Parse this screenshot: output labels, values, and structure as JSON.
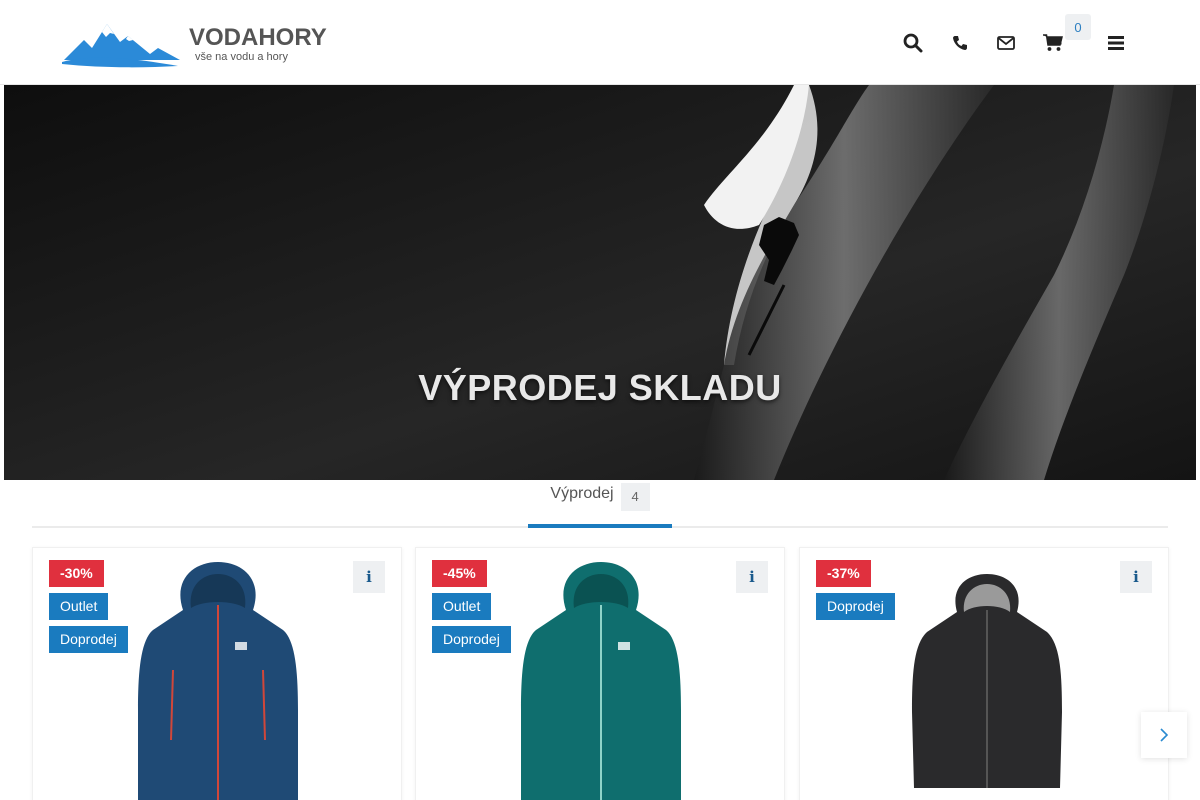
{
  "brand": {
    "name": "VODAHORY",
    "tagline": "vše na vodu a hory",
    "colors": {
      "primary": "#1a7bbf",
      "sale": "#e0303e",
      "logo_mountain": "#2b8ad8"
    }
  },
  "header": {
    "icons": [
      "search-icon",
      "phone-icon",
      "envelope-icon",
      "cart-icon",
      "menu-icon"
    ],
    "cart_count": "0"
  },
  "hero": {
    "title": "VÝPRODEJ SKLADU"
  },
  "tabs": [
    {
      "label": "Výprodej",
      "count": "4",
      "active": true
    }
  ],
  "products": [
    {
      "discount": "-30%",
      "labels": [
        "Outlet",
        "Doprodej"
      ],
      "color": "#1f4a75",
      "accent": "#d0473a"
    },
    {
      "discount": "-45%",
      "labels": [
        "Outlet",
        "Doprodej"
      ],
      "color": "#0f6e6e",
      "accent": "#8fd3c8"
    },
    {
      "discount": "-37%",
      "labels": [
        "Doprodej"
      ],
      "color": "#2a2a2c",
      "accent": "#777777"
    }
  ],
  "carousel": {
    "next_icon": "chevron-right-icon"
  }
}
